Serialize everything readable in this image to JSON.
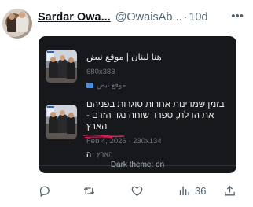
{
  "tweet": {
    "author_name": "Sardar Owa...",
    "handle": "@OwaisAb...",
    "separator": "·",
    "time": "10d",
    "more_icon": "more-horizontal-icon"
  },
  "embed": {
    "cards": [
      {
        "title": "هنا لبنان | موقع نبض",
        "meta": "680x383",
        "source": "موقع نبض",
        "source_icon": "blue-site-icon"
      },
      {
        "title": "בזמן שמדינות אחרות סוגרות בפניהם את הדלת, ספרד שוחה נגד הזרם - הארץ",
        "meta": "Feb 4, 2026 · 230x134",
        "source": "הארץ",
        "source_icon": "haaretz-icon"
      }
    ],
    "theme_status": "Dark theme: on"
  },
  "actions": {
    "reply_icon": "reply-icon",
    "retweet_icon": "retweet-icon",
    "like_icon": "heart-icon",
    "views_icon": "views-bar-chart-icon",
    "views_count": "36",
    "share_icon": "share-icon"
  },
  "colors": {
    "embed_bg": "#16181c",
    "text_secondary": "#536471",
    "annotation_red": "#e0245e"
  }
}
